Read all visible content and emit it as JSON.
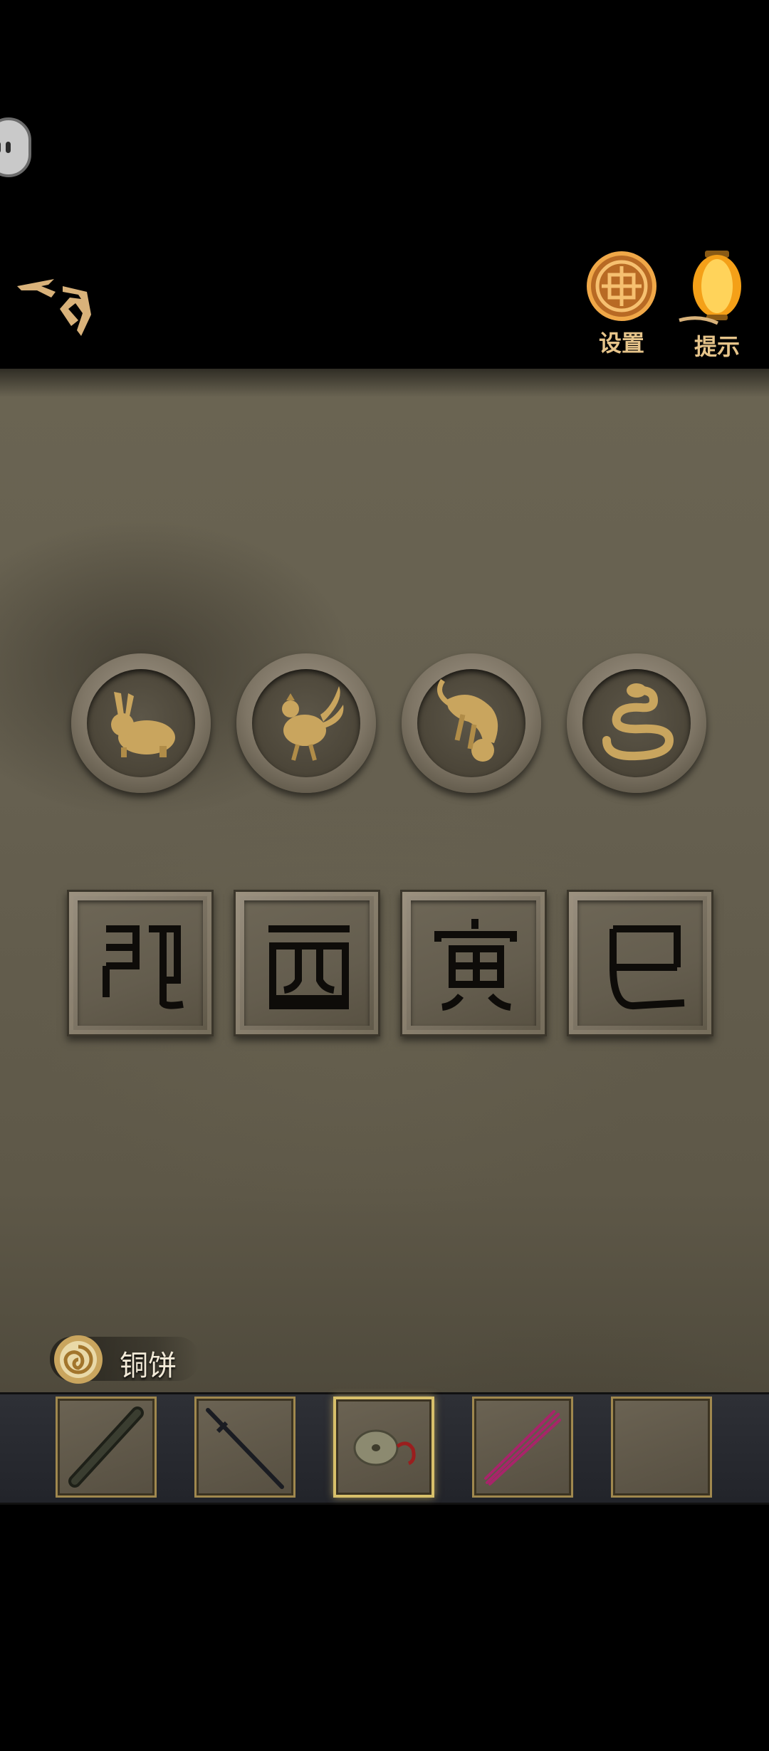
{
  "top_bar": {
    "settings_label": "设置",
    "hint_label": "提示",
    "accent_color": "#e6c48a"
  },
  "puzzle": {
    "medallions": [
      {
        "animal": "rabbit"
      },
      {
        "animal": "rooster"
      },
      {
        "animal": "tiger"
      },
      {
        "animal": "snake"
      }
    ],
    "tiles": [
      {
        "glyph": "卯"
      },
      {
        "glyph": "酉"
      },
      {
        "glyph": "寅"
      },
      {
        "glyph": "巳"
      }
    ]
  },
  "inventory": {
    "selected_item_name": "铜饼",
    "slots": [
      {
        "item": "scroll-tube-icon"
      },
      {
        "item": "sword-icon"
      },
      {
        "item": "bronze-disc-icon",
        "selected": true
      },
      {
        "item": "incense-sticks-icon"
      },
      {
        "item": "empty"
      }
    ]
  }
}
